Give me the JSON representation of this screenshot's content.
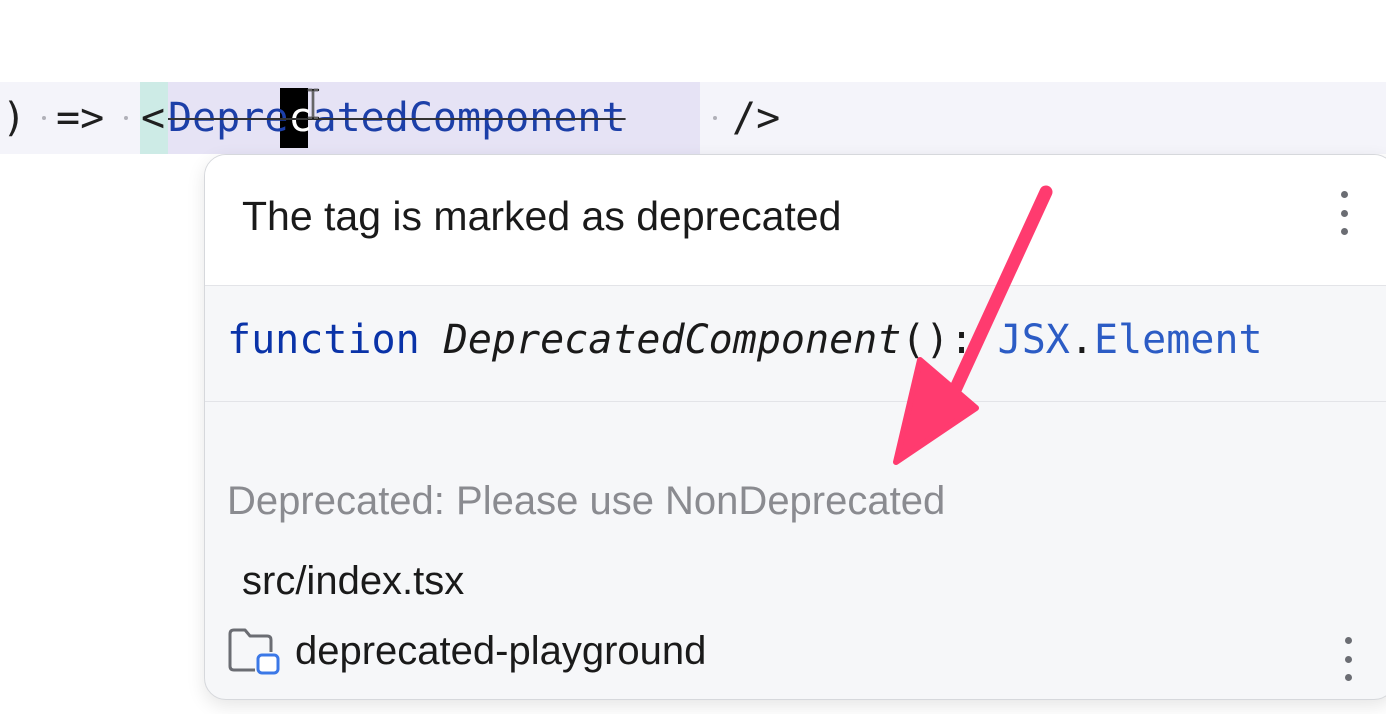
{
  "editor": {
    "paren": ")",
    "arrow": "=>",
    "open_bracket": "<",
    "tag_name_before_caret": "Depre",
    "tag_caret_char": "c",
    "tag_name_after_caret": "atedComponent",
    "self_close": "/>"
  },
  "popup": {
    "title": "The tag is marked as deprecated",
    "signature": {
      "keyword": "function",
      "name": "DeprecatedComponent",
      "params": "(): ",
      "return_namespace": "JSX",
      "dot": ".",
      "return_type": "Element"
    },
    "deprecated_note": "Deprecated: Please use NonDeprecated",
    "file_path": "src/index.tsx",
    "module_name": "deprecated-playground"
  },
  "icons": {
    "more_options": "more-vertical-icon",
    "module": "module-folder-icon",
    "annotation": "annotation-arrow"
  },
  "colors": {
    "keyword": "#0a33a8",
    "type": "#2c5cc5",
    "deprecated_tag": "#1c3fa8",
    "annotation_arrow": "#ff3b6f",
    "tag_highlight": "#e6e3f5",
    "bracket_highlight": "#cdebe6"
  }
}
